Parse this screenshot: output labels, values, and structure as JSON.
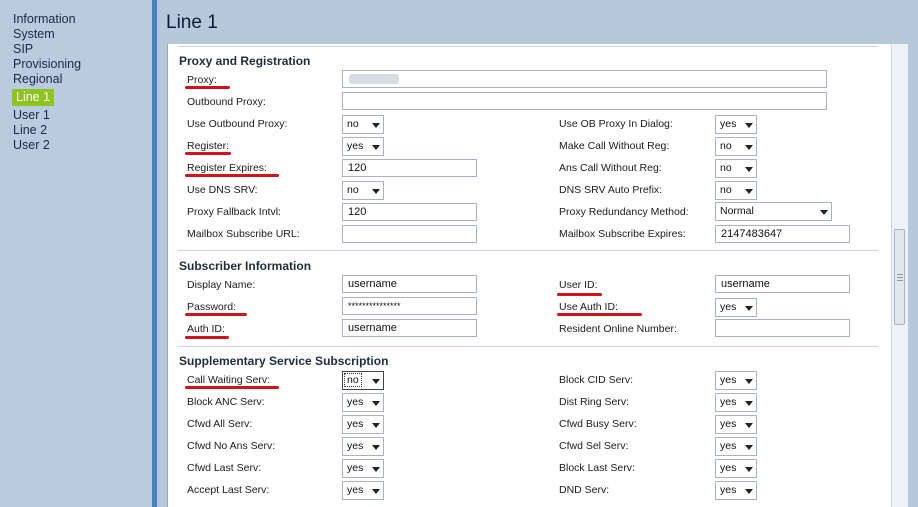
{
  "sidebar": {
    "items": [
      {
        "label": "Information"
      },
      {
        "label": "System"
      },
      {
        "label": "SIP"
      },
      {
        "label": "Provisioning"
      },
      {
        "label": "Regional"
      },
      {
        "label": "Line 1",
        "active": true
      },
      {
        "label": "User 1"
      },
      {
        "label": "Line 2"
      },
      {
        "label": "User 2"
      }
    ]
  },
  "page": {
    "title": "Line 1"
  },
  "sections": {
    "proxy": {
      "title": "Proxy and Registration",
      "proxy_label": "Proxy:",
      "proxy_value": "",
      "outbound_proxy_label": "Outbound Proxy:",
      "outbound_proxy_value": "",
      "use_outbound_proxy_label": "Use Outbound Proxy:",
      "use_outbound_proxy_value": "no",
      "register_label": "Register:",
      "register_value": "yes",
      "register_expires_label": "Register Expires:",
      "register_expires_value": "120",
      "use_dns_srv_label": "Use DNS SRV:",
      "use_dns_srv_value": "no",
      "proxy_fallback_label": "Proxy Fallback Intvl:",
      "proxy_fallback_value": "120",
      "mailbox_url_label": "Mailbox Subscribe URL:",
      "mailbox_url_value": "",
      "use_ob_proxy_dialog_label": "Use OB Proxy In Dialog:",
      "use_ob_proxy_dialog_value": "yes",
      "make_call_without_reg_label": "Make Call Without Reg:",
      "make_call_without_reg_value": "no",
      "ans_call_without_reg_label": "Ans Call Without Reg:",
      "ans_call_without_reg_value": "no",
      "dns_srv_auto_prefix_label": "DNS SRV Auto Prefix:",
      "dns_srv_auto_prefix_value": "no",
      "proxy_redundancy_label": "Proxy Redundancy Method:",
      "proxy_redundancy_value": "Normal",
      "mailbox_expires_label": "Mailbox Subscribe Expires:",
      "mailbox_expires_value": "2147483647"
    },
    "subscriber": {
      "title": "Subscriber Information",
      "display_name_label": "Display Name:",
      "display_name_value": "username",
      "password_label": "Password:",
      "password_value": "***************",
      "auth_id_label": "Auth ID:",
      "auth_id_value": "username",
      "user_id_label": "User ID:",
      "user_id_value": "username",
      "use_auth_id_label": "Use Auth ID:",
      "use_auth_id_value": "yes",
      "resident_online_label": "Resident Online Number:",
      "resident_online_value": ""
    },
    "supplementary": {
      "title": "Supplementary Service Subscription",
      "call_waiting_label": "Call Waiting Serv:",
      "call_waiting_value": "no",
      "block_anc_label": "Block ANC Serv:",
      "block_anc_value": "yes",
      "cfwd_all_label": "Cfwd All Serv:",
      "cfwd_all_value": "yes",
      "cfwd_no_ans_label": "Cfwd No Ans Serv:",
      "cfwd_no_ans_value": "yes",
      "cfwd_last_label": "Cfwd Last Serv:",
      "cfwd_last_value": "yes",
      "accept_last_label": "Accept Last Serv:",
      "accept_last_value": "yes",
      "block_cid_label": "Block CID Serv:",
      "block_cid_value": "yes",
      "dist_ring_label": "Dist Ring Serv:",
      "dist_ring_value": "yes",
      "cfwd_busy_label": "Cfwd Busy Serv:",
      "cfwd_busy_value": "yes",
      "cfwd_sel_label": "Cfwd Sel Serv:",
      "cfwd_sel_value": "yes",
      "block_last_label": "Block Last Serv:",
      "block_last_value": "yes",
      "dnd_label": "DND Serv:",
      "dnd_value": "yes"
    }
  },
  "colors": {
    "sidebar_bg": "#b9cbdf",
    "active_nav": "#8fc31f",
    "annotation_underline": "#d0141a",
    "main_bg": "#b6c8dc"
  }
}
